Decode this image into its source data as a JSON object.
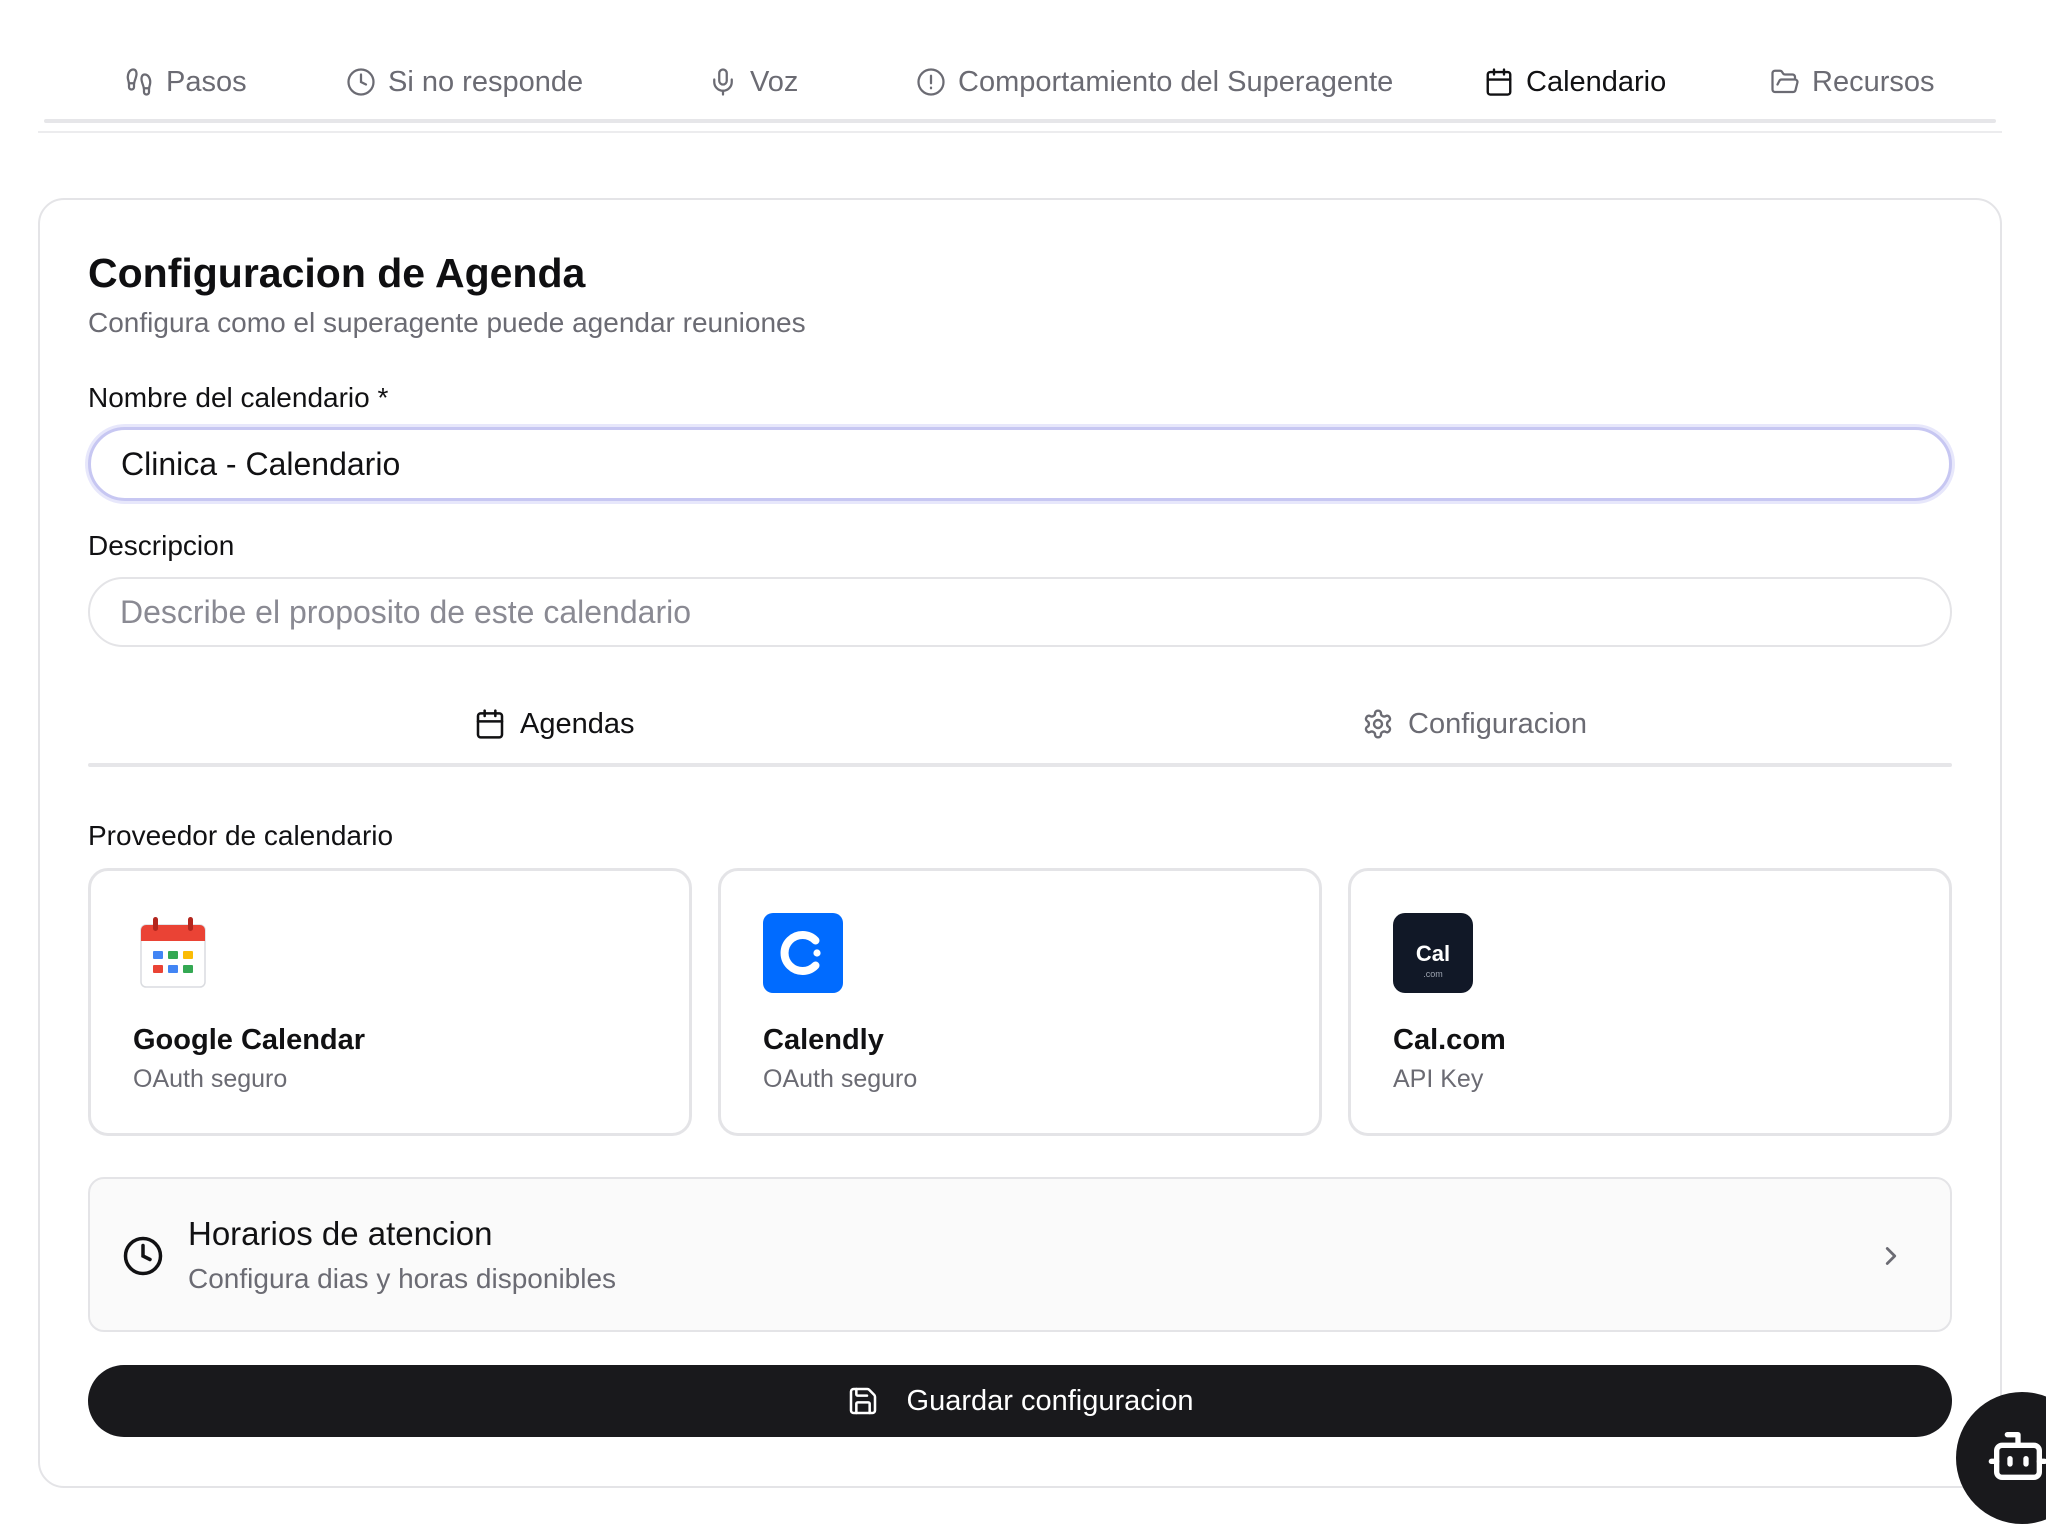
{
  "top_tabs": [
    {
      "label": "Pasos",
      "icon": "footprints-icon",
      "active": false
    },
    {
      "label": "Si no responde",
      "icon": "clock-icon",
      "active": false
    },
    {
      "label": "Voz",
      "icon": "microphone-icon",
      "active": false
    },
    {
      "label": "Comportamiento del Superagente",
      "icon": "alert-circle-icon",
      "active": false
    },
    {
      "label": "Calendario",
      "icon": "calendar-icon",
      "active": true
    },
    {
      "label": "Recursos",
      "icon": "folder-open-icon",
      "active": false
    }
  ],
  "card": {
    "title": "Configuracion de Agenda",
    "subtitle": "Configura como el superagente puede agendar reuniones"
  },
  "form": {
    "name_label": "Nombre del calendario *",
    "name_value": "Clinica - Calendario",
    "description_label": "Descripcion",
    "description_value": "",
    "description_placeholder": "Describe el proposito de este calendario"
  },
  "inner_tabs": [
    {
      "label": "Agendas",
      "icon": "calendar-icon",
      "active": true
    },
    {
      "label": "Configuracion",
      "icon": "gear-icon",
      "active": false
    }
  ],
  "providers_section": {
    "label": "Proveedor de calendario",
    "items": [
      {
        "name": "Google Calendar",
        "auth": "OAuth seguro",
        "icon": "google-calendar-logo"
      },
      {
        "name": "Calendly",
        "auth": "OAuth seguro",
        "icon": "calendly-logo",
        "brand_color": "#006BFF"
      },
      {
        "name": "Cal.com",
        "auth": "API Key",
        "icon": "calcom-logo",
        "logo_text": "Cal",
        "logo_subtext": ".com",
        "brand_color": "#111827"
      }
    ]
  },
  "hours": {
    "title": "Horarios de atencion",
    "subtitle": "Configura dias y horas disponibles"
  },
  "save_button": {
    "label": "Guardar configuracion"
  },
  "colors": {
    "accent_dark": "#19191c",
    "muted_text": "#6b6b73",
    "border": "#e4e4e7",
    "focus_ring": "#c7c7f2"
  }
}
